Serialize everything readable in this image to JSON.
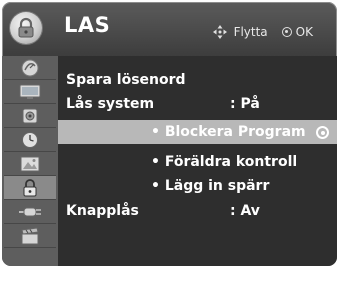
{
  "header": {
    "title": "LAS",
    "icon": "lock-icon",
    "hints": {
      "move_label": "Flytta",
      "ok_label": "OK"
    }
  },
  "sidebar": {
    "items": [
      {
        "icon": "satellite-dish-icon",
        "active": false
      },
      {
        "icon": "tv-screen-icon",
        "active": false
      },
      {
        "icon": "speaker-icon",
        "active": false
      },
      {
        "icon": "clock-icon",
        "active": false
      },
      {
        "icon": "picture-icon",
        "active": false
      },
      {
        "icon": "lock-icon",
        "active": true
      },
      {
        "icon": "input-plug-icon",
        "active": false
      },
      {
        "icon": "clapperboard-icon",
        "active": false
      }
    ]
  },
  "menu": {
    "rows": [
      {
        "label": "Spara lösenord",
        "value": ""
      },
      {
        "label": "Lås system",
        "value": ": På"
      },
      {
        "label": "Blockera Program",
        "selected": true
      },
      {
        "label": "Föräldra kontroll"
      },
      {
        "label": "Lägg in spärr"
      },
      {
        "label": "Knapplås",
        "value": ": Av"
      }
    ]
  },
  "colors": {
    "panel": "#3b3b3b",
    "highlight": "#b8b8b8",
    "sidebar": "#5e5e5e",
    "text": "#ffffff"
  }
}
